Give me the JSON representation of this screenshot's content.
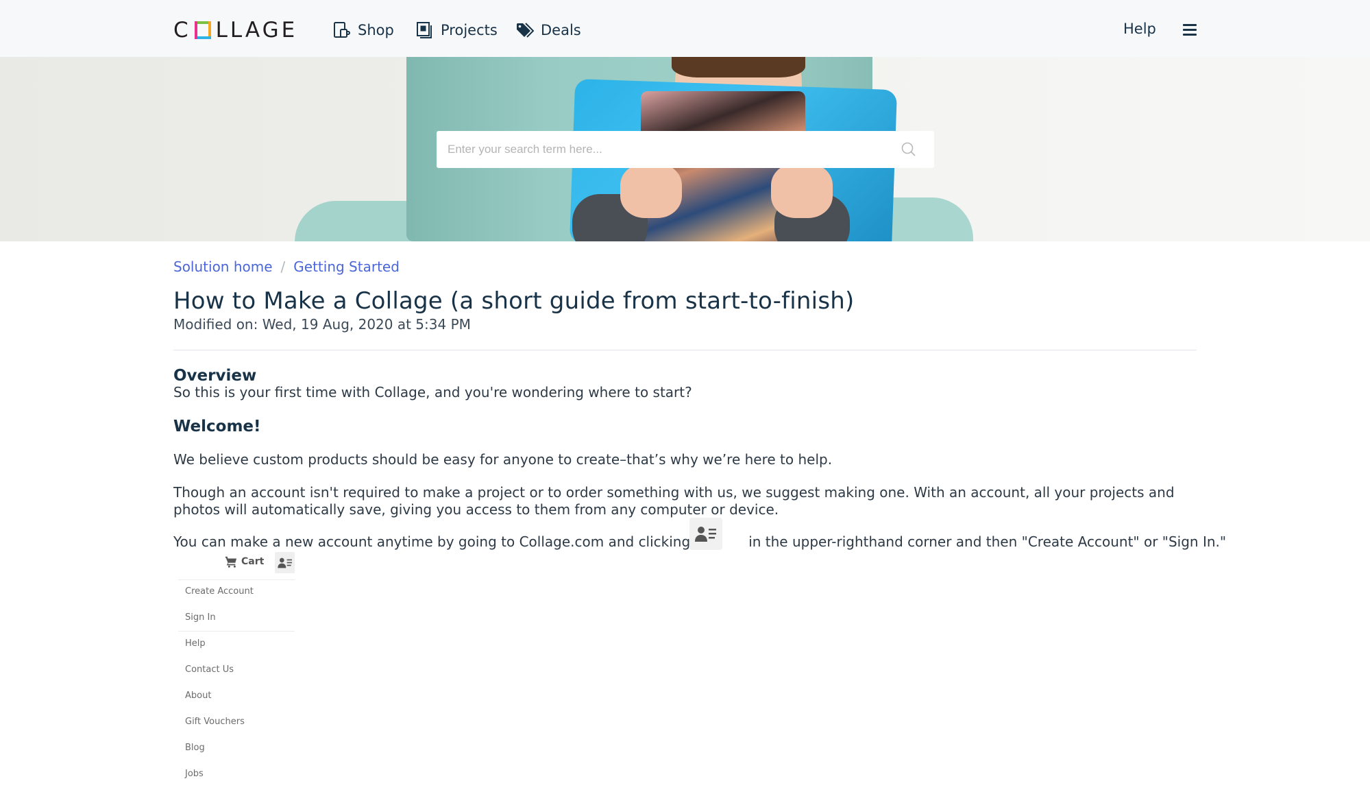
{
  "header": {
    "logo_text": "COLLAGE",
    "logo_colors": {
      "top": "#7ac143",
      "right": "#f7a823",
      "bottom": "#2fb3e6",
      "left": "#ec2f8c"
    },
    "nav": [
      {
        "label": "Shop",
        "icon": "mug-device-icon"
      },
      {
        "label": "Projects",
        "icon": "photo-stack-icon"
      },
      {
        "label": "Deals",
        "icon": "tags-icon"
      }
    ],
    "help_label": "Help",
    "menu_icon": "hamburger-icon"
  },
  "hero": {
    "search": {
      "placeholder": "Enter your search term here...",
      "value": "",
      "icon": "search-icon"
    }
  },
  "breadcrumb": {
    "items": [
      "Solution home",
      "Getting Started"
    ],
    "separator": "/"
  },
  "article": {
    "title": "How to Make a Collage (a short guide from start-to-finish)",
    "modified": "Modified on: Wed, 19 Aug, 2020 at 5:34 PM",
    "overview_heading": "Overview",
    "overview_text": "So this is your first time with Collage, and you're wondering where to start?",
    "welcome_heading": "Welcome!",
    "para1": "We believe custom products should be easy for anyone to create–that’s why we’re here to help.",
    "para2": "Though an account isn't required to make a project or to order something with us, we suggest making one. With an account, all your projects and photos will automatically save, giving you access to them from any computer or device.",
    "para3_before": "You can make a new account anytime by going to Collage.com and clicking",
    "para3_after": "in the upper-righthand corner and then \"Create Account\" or \"Sign In.\"",
    "inline_icon": "account-menu-icon"
  },
  "menu_screenshot": {
    "cart_label": "Cart",
    "cart_icon": "cart-icon",
    "account_icon": "account-menu-icon",
    "account_items": [
      "Create Account",
      "Sign In"
    ],
    "site_items": [
      "Help",
      "Contact Us",
      "About",
      "Gift Vouchers",
      "Blog",
      "Jobs"
    ]
  },
  "colors": {
    "header_bg": "#f7f8fa",
    "text_primary": "#183247",
    "link": "#4a66d9"
  }
}
